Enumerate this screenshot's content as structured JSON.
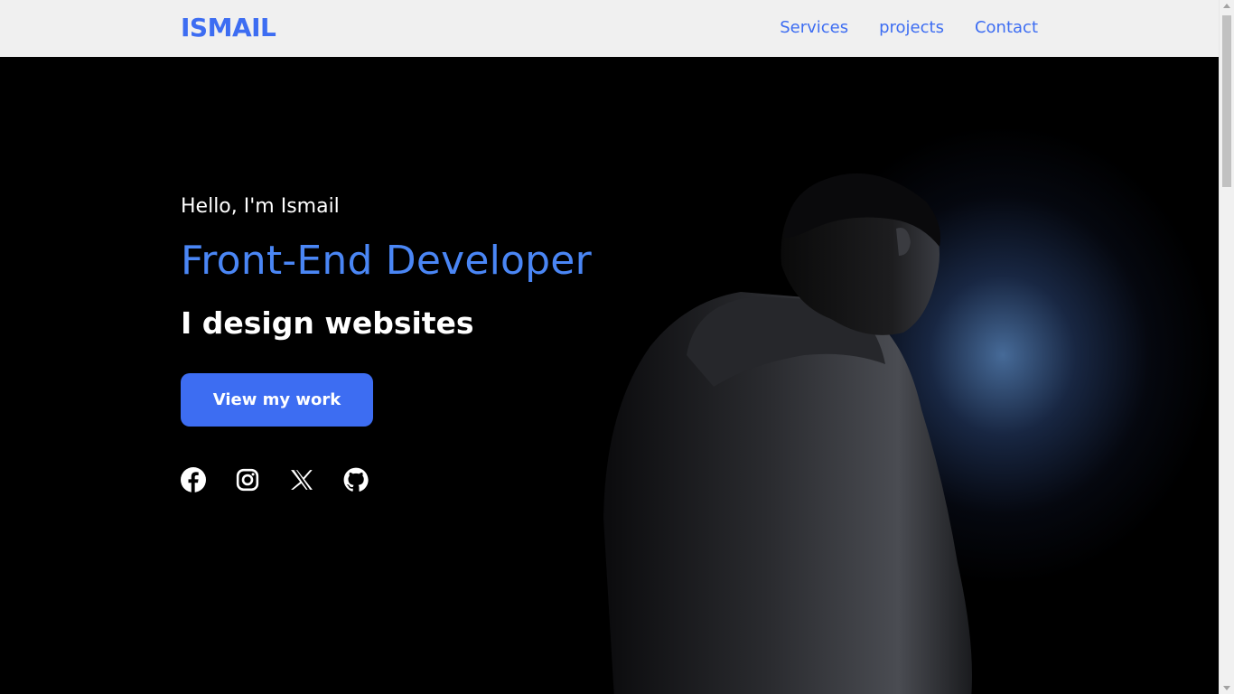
{
  "header": {
    "logo": "ISMAIL",
    "nav": [
      {
        "label": "Services"
      },
      {
        "label": "projects"
      },
      {
        "label": "Contact"
      }
    ]
  },
  "hero": {
    "greeting": "Hello, I'm Ismail",
    "role": "Front-End Developer",
    "tagline": "I design websites",
    "cta_label": "View my work",
    "socials": [
      {
        "icon": "facebook-icon"
      },
      {
        "icon": "instagram-icon"
      },
      {
        "icon": "x-icon"
      },
      {
        "icon": "github-icon"
      }
    ]
  },
  "colors": {
    "accent": "#3d6df2",
    "role_text": "#4a86f5",
    "nav_background": "#f0f0f0",
    "hero_background": "#000000"
  }
}
